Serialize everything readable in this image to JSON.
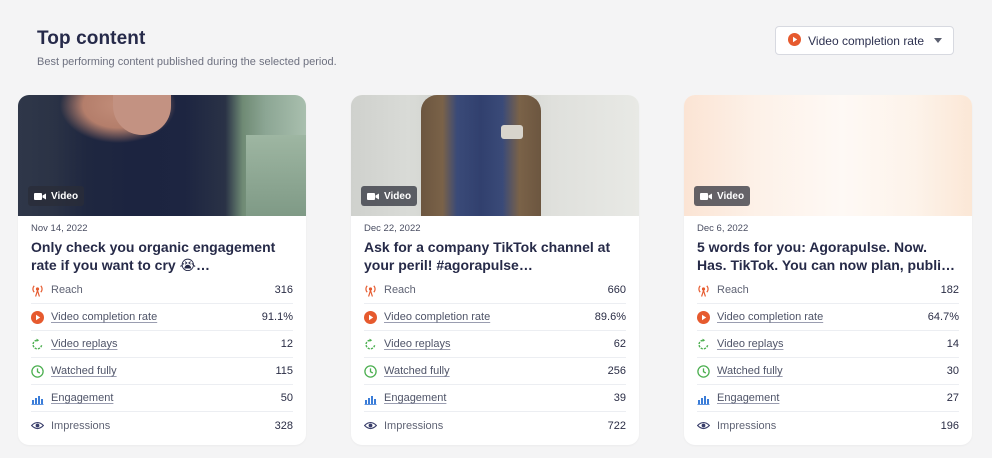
{
  "header": {
    "title": "Top content",
    "subtitle": "Best performing content published during the selected period."
  },
  "metric_select": {
    "selected": "Video completion rate"
  },
  "colors": {
    "accent_orange": "#e65a2e",
    "replay_green": "#4caf50",
    "engagement_blue": "#3b7dd8",
    "impressions_navy": "#3a3f6b"
  },
  "cards": [
    {
      "badge": "Video",
      "date": "Nov 14, 2022",
      "title": "Only check you organic engagement rate if you want to cry 😭…",
      "metrics": [
        {
          "icon": "reach-icon",
          "label": "Reach",
          "value": "316"
        },
        {
          "icon": "play-circle-icon",
          "label": "Video completion rate",
          "value": "91.1%"
        },
        {
          "icon": "replay-icon",
          "label": "Video replays",
          "value": "12"
        },
        {
          "icon": "clock-icon",
          "label": "Watched fully",
          "value": "115"
        },
        {
          "icon": "bar-chart-icon",
          "label": "Engagement",
          "value": "50"
        },
        {
          "icon": "eye-icon",
          "label": "Impressions",
          "value": "328"
        }
      ]
    },
    {
      "badge": "Video",
      "date": "Dec 22, 2022",
      "title": "Ask for a company TikTok channel at your peril! #agorapulse…",
      "metrics": [
        {
          "icon": "reach-icon",
          "label": "Reach",
          "value": "660"
        },
        {
          "icon": "play-circle-icon",
          "label": "Video completion rate",
          "value": "89.6%"
        },
        {
          "icon": "replay-icon",
          "label": "Video replays",
          "value": "62"
        },
        {
          "icon": "clock-icon",
          "label": "Watched fully",
          "value": "256"
        },
        {
          "icon": "bar-chart-icon",
          "label": "Engagement",
          "value": "39"
        },
        {
          "icon": "eye-icon",
          "label": "Impressions",
          "value": "722"
        }
      ]
    },
    {
      "badge": "Video",
      "date": "Dec 6, 2022",
      "title": "5 words for you: Agorapulse. Now. Has. TikTok. You can now plan, publi…",
      "metrics": [
        {
          "icon": "reach-icon",
          "label": "Reach",
          "value": "182"
        },
        {
          "icon": "play-circle-icon",
          "label": "Video completion rate",
          "value": "64.7%"
        },
        {
          "icon": "replay-icon",
          "label": "Video replays",
          "value": "14"
        },
        {
          "icon": "clock-icon",
          "label": "Watched fully",
          "value": "30"
        },
        {
          "icon": "bar-chart-icon",
          "label": "Engagement",
          "value": "27"
        },
        {
          "icon": "eye-icon",
          "label": "Impressions",
          "value": "196"
        }
      ]
    }
  ]
}
